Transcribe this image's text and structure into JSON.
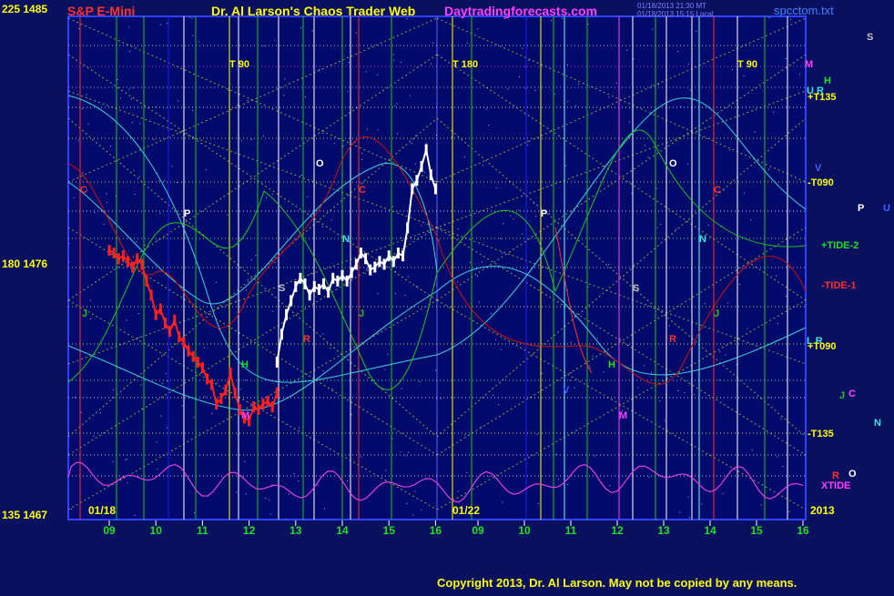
{
  "header": {
    "instrument": "S&P E-Mini",
    "title": "Dr. Al Larson's Chaos Trader Web",
    "site": "Daytradingforecasts.com",
    "file": "spcctom.txt",
    "date_line_1": "01/18/2013 21:30 MT",
    "date_line_2": "01/18/2013 15:15 Local"
  },
  "copyright": "Copyright 2013, Dr. Al Larson. May not be copied by any means.",
  "colors": {
    "background": "#0a1060",
    "plot_background": "#000a6a",
    "price_red": "#ff2020",
    "price_white": "#ffffff",
    "cyan": "#40e0e0",
    "green": "#20c020",
    "dark_red": "#c01010",
    "magenta": "#e040e0",
    "yellow": "#ffff00"
  },
  "chart_data": {
    "type": "line",
    "y_labels": [
      {
        "angle": "225",
        "price": "1485",
        "value": 1485
      },
      {
        "angle": "180",
        "price": "1476",
        "value": 1476
      },
      {
        "angle": "135",
        "price": "1467",
        "value": 1467
      }
    ],
    "ylim": [
      1467,
      1485
    ],
    "panels": [
      {
        "date": "01/18",
        "hours": [
          "09",
          "10",
          "11",
          "12",
          "13",
          "14",
          "15",
          "16"
        ]
      },
      {
        "date": "01/22",
        "hours": [
          "09",
          "10",
          "11",
          "12",
          "13",
          "14",
          "15",
          "16"
        ]
      }
    ],
    "year_label": "2013",
    "top_markers": [
      "T 90",
      "T 180",
      "T 90",
      "M"
    ],
    "right_labels": {
      "H": "H",
      "UR_top": "U R",
      "plus135": "+T135",
      "V": "V",
      "T090": "-T090",
      "tide2": "+TIDE-2",
      "tide1": "-TIDE-1",
      "LR": "L R",
      "plus090": "+T090",
      "T135": "-T135",
      "xtide": "XTIDE"
    },
    "planet_column": [
      "S",
      "P",
      "U",
      "J",
      "C",
      "N",
      "R",
      "O"
    ],
    "series": [
      {
        "kind": "price_red",
        "x": [
          9.0,
          9.1,
          9.2,
          9.3,
          9.4,
          9.5,
          9.6,
          9.7,
          9.8,
          9.9,
          10.0,
          10.1,
          10.2,
          10.3,
          10.4,
          10.5,
          10.6,
          10.7,
          10.8,
          10.9,
          11.0,
          11.1,
          11.2,
          11.3,
          11.4,
          11.5,
          11.6,
          11.7,
          11.8,
          11.9,
          12.0,
          12.1,
          12.2,
          12.3,
          12.4,
          12.5,
          12.6
        ],
        "y": [
          1476.6,
          1476.5,
          1476.3,
          1476.4,
          1476.2,
          1476.0,
          1476.3,
          1476.1,
          1475.5,
          1475.0,
          1474.3,
          1474.5,
          1474.0,
          1473.7,
          1474.1,
          1473.5,
          1473.3,
          1473.0,
          1472.8,
          1472.6,
          1472.4,
          1472.0,
          1471.8,
          1471.1,
          1471.3,
          1471.6,
          1472.2,
          1471.5,
          1470.9,
          1470.6,
          1470.5,
          1471.0,
          1470.9,
          1471.1,
          1471.2,
          1471.0,
          1471.5
        ]
      },
      {
        "kind": "price_white",
        "x": [
          12.6,
          12.7,
          12.8,
          12.9,
          13.0,
          13.1,
          13.2,
          13.3,
          13.4,
          13.5,
          13.6,
          13.7,
          13.8,
          13.9,
          14.0,
          14.1,
          14.2,
          14.3,
          14.4,
          14.5,
          14.6,
          14.7,
          14.8,
          14.9,
          15.0,
          15.1,
          15.2,
          15.3,
          15.4,
          15.5,
          15.6,
          15.7,
          15.8,
          15.9,
          16.0
        ],
        "y": [
          1472.6,
          1473.6,
          1474.3,
          1474.8,
          1475.3,
          1475.6,
          1475.4,
          1475.0,
          1475.3,
          1475.2,
          1475.4,
          1475.1,
          1475.6,
          1475.5,
          1475.7,
          1475.5,
          1475.8,
          1476.1,
          1476.5,
          1476.3,
          1475.9,
          1476.0,
          1476.2,
          1476.1,
          1476.4,
          1476.2,
          1476.5,
          1476.4,
          1477.4,
          1478.8,
          1479.1,
          1479.6,
          1480.2,
          1479.3,
          1478.8
        ]
      }
    ]
  }
}
